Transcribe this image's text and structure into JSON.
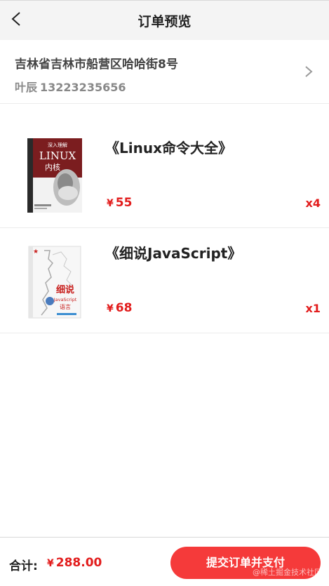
{
  "header": {
    "title": "订单预览"
  },
  "address": {
    "full": "吉林省吉林市船营区哈哈街8号",
    "name": "叶辰",
    "phone": "13223235656"
  },
  "currency_symbol": "¥",
  "items": [
    {
      "title": "《Linux命令大全》",
      "price": "55",
      "qty": "x4",
      "cover": {
        "top_label": "深入理解",
        "main_label": "LINUX",
        "sub_label": "内核",
        "color": "#7b1d1f"
      }
    },
    {
      "title": "《细说JavaScript》",
      "price": "68",
      "qty": "x1",
      "cover": {
        "main_label": "细说",
        "sub_label": "JavaScript",
        "bottom_label": "语言",
        "color": "#c8201e"
      }
    }
  ],
  "footer": {
    "total_label": "合计:",
    "total_amount": "288.00",
    "submit_label": "提交订单并支付",
    "watermark": "@稀土掘金技术社区"
  },
  "colors": {
    "accent": "#e21c1c",
    "button": "#f53a3a",
    "header_bg": "#f4f4f4"
  }
}
